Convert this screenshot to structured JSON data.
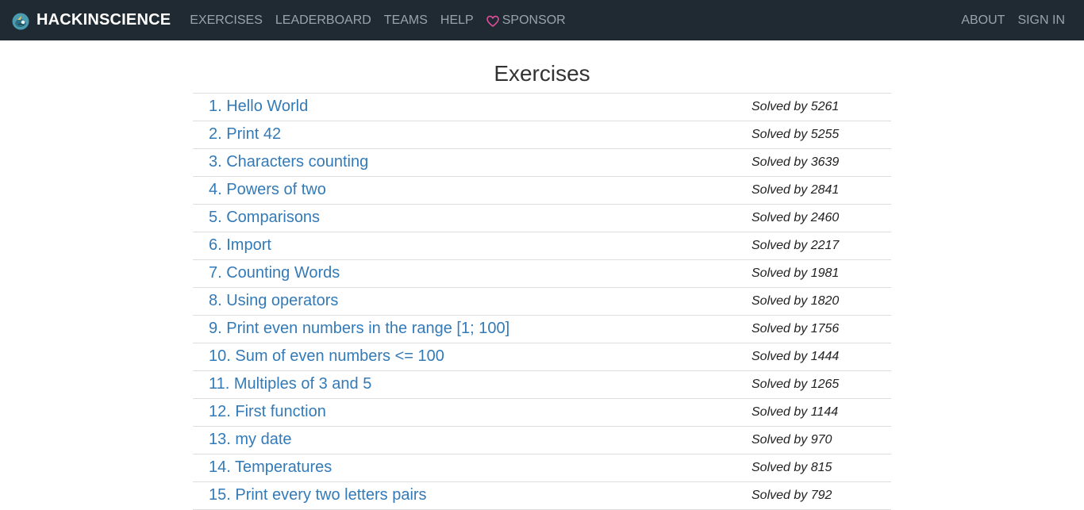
{
  "navbar": {
    "brand": "HACKINSCIENCE",
    "links": [
      "EXERCISES",
      "LEADERBOARD",
      "TEAMS",
      "HELP"
    ],
    "sponsor": "SPONSOR",
    "right_links": [
      "ABOUT",
      "SIGN IN"
    ],
    "background": "#1f2a33",
    "link_color": "#9aa3ab",
    "heart_color": "#e04e9b"
  },
  "page": {
    "title": "Exercises"
  },
  "exercises": [
    {
      "title": "1. Hello World",
      "solved": "Solved by 5261"
    },
    {
      "title": "2. Print 42",
      "solved": "Solved by 5255"
    },
    {
      "title": "3. Characters counting",
      "solved": "Solved by 3639"
    },
    {
      "title": "4. Powers of two",
      "solved": "Solved by 2841"
    },
    {
      "title": "5. Comparisons",
      "solved": "Solved by 2460"
    },
    {
      "title": "6. Import",
      "solved": "Solved by 2217"
    },
    {
      "title": "7. Counting Words",
      "solved": "Solved by 1981"
    },
    {
      "title": "8. Using operators",
      "solved": "Solved by 1820"
    },
    {
      "title": "9. Print even numbers in the range [1; 100]",
      "solved": "Solved by 1756"
    },
    {
      "title": "10. Sum of even numbers <= 100",
      "solved": "Solved by 1444"
    },
    {
      "title": "11. Multiples of 3 and 5",
      "solved": "Solved by 1265"
    },
    {
      "title": "12. First function",
      "solved": "Solved by 1144"
    },
    {
      "title": "13. my date",
      "solved": "Solved by 970"
    },
    {
      "title": "14. Temperatures",
      "solved": "Solved by 815"
    },
    {
      "title": "15. Print every two letters pairs",
      "solved": "Solved by 792"
    }
  ],
  "colors": {
    "link": "#337ab7",
    "divider": "#dddddd"
  }
}
